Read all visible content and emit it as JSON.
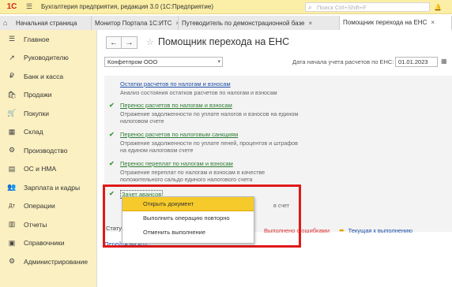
{
  "titlebar": {
    "logo": "1С",
    "title": "Бухгалтерия предприятия, редакция 3.0  (1С:Предприятие)",
    "search_placeholder": "Поиск Ctrl+Shift+F"
  },
  "tabs": [
    {
      "label": "Начальная страница"
    },
    {
      "label": "Монитор Портала 1С:ИТС",
      "close": "×"
    },
    {
      "label": "Путеводитель по демонстрационной базе",
      "close": "×"
    },
    {
      "label": "Помощник перехода на ЕНС",
      "close": "×"
    }
  ],
  "sidebar": {
    "items": [
      {
        "label": "Главное",
        "icon": "☰"
      },
      {
        "label": "Руководителю",
        "icon": "↗"
      },
      {
        "label": "Банк и касса",
        "icon": "₽"
      },
      {
        "label": "Продажи",
        "icon": "🛍"
      },
      {
        "label": "Покупки",
        "icon": "🛒"
      },
      {
        "label": "Склад",
        "icon": "▦"
      },
      {
        "label": "Производство",
        "icon": "⚙"
      },
      {
        "label": "ОС и НМА",
        "icon": "▤"
      },
      {
        "label": "Зарплата и кадры",
        "icon": "👥"
      },
      {
        "label": "Операции",
        "icon": "Дт"
      },
      {
        "label": "Отчеты",
        "icon": "▥"
      },
      {
        "label": "Справочники",
        "icon": "▣"
      },
      {
        "label": "Администрирование",
        "icon": "⚙"
      }
    ]
  },
  "page": {
    "title": "Помощник перехода на ЕНС",
    "organization": "Конфетпром ООО",
    "date_label": "Дата начала учета расчетов по ЕНС:",
    "date_value": "01.01.2023"
  },
  "steps": [
    {
      "link": "Остатки расчетов по налогам и взносам",
      "desc": "Анализ состояния остатков расчетов по налогам и взносам",
      "done": false
    },
    {
      "link": "Перенос расчетов по налогам и взносам",
      "desc": "Отражение задолженности по уплате налогов и взносов на едином налоговом счете",
      "done": true
    },
    {
      "link": "Перенос расчетов по налоговым санкциям",
      "desc": "Отражение задолженности по уплате пеней, процентов и штрафов на едином налоговом счете",
      "done": true
    },
    {
      "link": "Перенос переплат по налогам и взносам",
      "desc": "Отражение переплат по налогам и взносам в качестве положительного сальдо единого налогового счета",
      "done": true
    },
    {
      "link": "Зачет авансов",
      "desc": "в счет",
      "done": true
    }
  ],
  "context_menu": {
    "items": [
      "Открыть документ",
      "Выполнить операцию повторно",
      "Отменить выполнение"
    ],
    "selected_index": 0
  },
  "status": {
    "label": "Статус:",
    "errors": "Выполнено с ошибками",
    "current": "Текущая к выполнению"
  },
  "bottom_link": "Перейти на ИТС"
}
